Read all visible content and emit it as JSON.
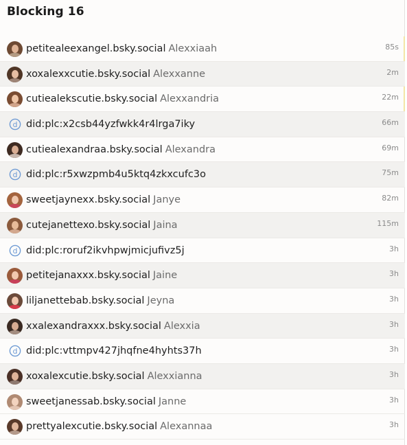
{
  "header": {
    "title": "Blocking 16"
  },
  "rows": [
    {
      "type": "user",
      "handle": "petitealeexangel.bsky.social",
      "display": "Alexxiaah",
      "time": "85s",
      "hair": "#6e4a33",
      "skin": "#e0b496",
      "top": "#b39a82",
      "alt": false,
      "highlight": true
    },
    {
      "type": "user",
      "handle": "xoxalexxcutie.bsky.social",
      "display": "Alexxanne",
      "time": "2m",
      "hair": "#4f3525",
      "skin": "#e6bea3",
      "top": "#9e8476",
      "alt": true,
      "highlight": false
    },
    {
      "type": "user",
      "handle": "cutiealekscutie.bsky.social",
      "display": "Alexxandria",
      "time": "22m",
      "hair": "#7a4c32",
      "skin": "#efc5a6",
      "top": "#d1a48a",
      "alt": false,
      "highlight": true
    },
    {
      "type": "did",
      "handle": "did:plc:x2csb44yzfwkk4r4lrga7iky",
      "display": "",
      "time": "66m",
      "icon": "did-icon",
      "alt": true,
      "highlight": false
    },
    {
      "type": "user",
      "handle": "cutiealexandraa.bsky.social",
      "display": "Alexandra",
      "time": "69m",
      "hair": "#3f2b22",
      "skin": "#d9ad93",
      "top": "#c9b7ad",
      "alt": false,
      "highlight": false
    },
    {
      "type": "did",
      "handle": "did:plc:r5xwzpmb4u5ktq4zkxcufc3o",
      "display": "",
      "time": "75m",
      "icon": "did-icon",
      "alt": true,
      "highlight": false
    },
    {
      "type": "user",
      "handle": "sweetjaynexx.bsky.social",
      "display": "Janye",
      "time": "82m",
      "hair": "#a4643e",
      "skin": "#f0c7ad",
      "top": "#c9465a",
      "alt": false,
      "highlight": false
    },
    {
      "type": "user",
      "handle": "cutejanettexo.bsky.social",
      "display": "Jaina",
      "time": "115m",
      "hair": "#8b5a3c",
      "skin": "#e8bb99",
      "top": "#d3a88e",
      "alt": true,
      "highlight": false
    },
    {
      "type": "did",
      "handle": "did:plc:roruf2ikvhpwjmicjufivz5j",
      "display": "",
      "time": "3h",
      "icon": "did-icon",
      "alt": false,
      "highlight": false
    },
    {
      "type": "user",
      "handle": "petitejanaxxx.bsky.social",
      "display": "Jaine",
      "time": "3h",
      "hair": "#9a5a3a",
      "skin": "#f2c8ad",
      "top": "#c8405a",
      "alt": true,
      "highlight": false
    },
    {
      "type": "user",
      "handle": "liljanettebab.bsky.social",
      "display": "Jeyna",
      "time": "3h",
      "hair": "#6b4a3a",
      "skin": "#efc6ae",
      "top": "#d63a4a",
      "alt": false,
      "highlight": false
    },
    {
      "type": "user",
      "handle": "xxalexandraxxx.bsky.social",
      "display": "Alexxia",
      "time": "3h",
      "hair": "#3a2a22",
      "skin": "#d7ab91",
      "top": "#a48d80",
      "alt": true,
      "highlight": false
    },
    {
      "type": "did",
      "handle": "did:plc:vttmpv427jhqfne4hyhts37h",
      "display": "",
      "time": "3h",
      "icon": "did-icon",
      "alt": false,
      "highlight": false
    },
    {
      "type": "user",
      "handle": "xoxalexcutie.bsky.social",
      "display": "Alexxianna",
      "time": "3h",
      "hair": "#4a3026",
      "skin": "#dfb399",
      "top": "#8f7a70",
      "alt": true,
      "highlight": false
    },
    {
      "type": "user",
      "handle": "sweetjanessab.bsky.social",
      "display": "Janne",
      "time": "3h",
      "hair": "#b08a73",
      "skin": "#f3d3bf",
      "top": "#e4c5b3",
      "alt": false,
      "highlight": false
    },
    {
      "type": "user",
      "handle": "prettyalexcutie.bsky.social",
      "display": "Alexannaa",
      "time": "3h",
      "hair": "#5a3a2a",
      "skin": "#e2b79c",
      "top": "#b59a8b",
      "alt": false,
      "highlight": false
    }
  ],
  "colors": {
    "did_icon": "#6f9bd4"
  }
}
